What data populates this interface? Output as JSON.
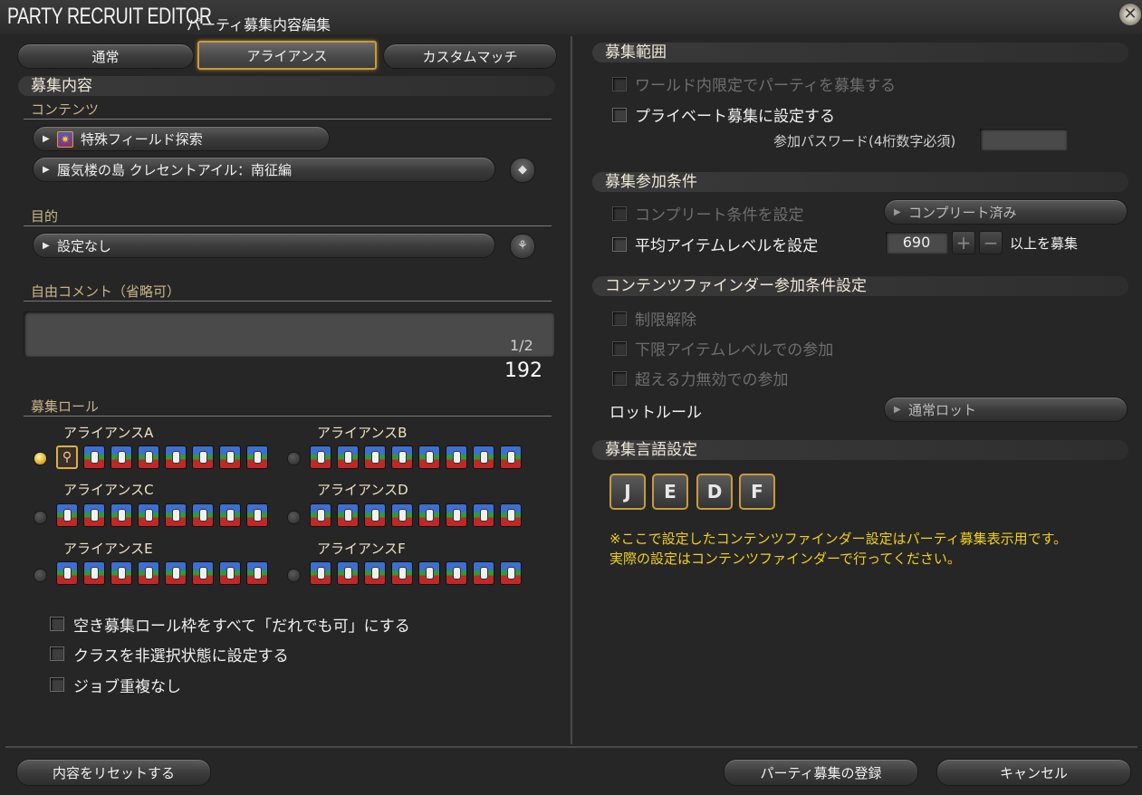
{
  "window": {
    "title": "PARTY RECRUIT EDITOR",
    "subtitle": "パーティ募集内容編集",
    "close_icon": "close-icon"
  },
  "tabs": [
    {
      "label": "通常",
      "active": false
    },
    {
      "label": "アライアンス",
      "active": true
    },
    {
      "label": "カスタムマッチ",
      "active": false
    }
  ],
  "left": {
    "section_title": "募集内容",
    "contents": {
      "heading": "コンテンツ",
      "category": "特殊フィールド探索",
      "duty": "蜃気楼の島 クレセントアイル：南征編"
    },
    "objective": {
      "heading": "目的",
      "value": "設定なし"
    },
    "comment": {
      "heading": "自由コメント（省略可）",
      "value": "",
      "page": "1/2",
      "remaining": "192"
    },
    "roles": {
      "heading": "募集ロール",
      "alliances": [
        {
          "name": "アライアンスA",
          "selected": true
        },
        {
          "name": "アライアンスB",
          "selected": false
        },
        {
          "name": "アライアンスC",
          "selected": false
        },
        {
          "name": "アライアンスD",
          "selected": false
        },
        {
          "name": "アライアンスE",
          "selected": false
        },
        {
          "name": "アライアンスF",
          "selected": false
        }
      ]
    },
    "options": [
      {
        "label": "空き募集ロール枠をすべて「だれでも可」にする",
        "checked": false
      },
      {
        "label": "クラスを非選択状態に設定する",
        "checked": false
      },
      {
        "label": "ジョブ重複なし",
        "checked": false
      }
    ]
  },
  "right": {
    "scope": {
      "title": "募集範囲",
      "world_only": "ワールド内限定でパーティを募集する",
      "private": "プライベート募集に設定する",
      "password_label": "参加パスワード(4桁数字必須)",
      "password_value": ""
    },
    "conditions": {
      "title": "募集参加条件",
      "complete_label": "コンプリート条件を設定",
      "complete_value": "コンプリート済み",
      "avg_ilvl_label": "平均アイテムレベルを設定",
      "avg_ilvl_value": "690",
      "plus": "+",
      "minus": "−",
      "avg_ilvl_suffix": "以上を募集"
    },
    "cf": {
      "title": "コンテンツファインダー参加条件設定",
      "unrestricted": "制限解除",
      "min_ilvl": "下限アイテムレベルでの参加",
      "echo_off": "超える力無効での参加",
      "loot_label": "ロットルール",
      "loot_value": "通常ロット"
    },
    "language": {
      "title": "募集言語設定",
      "keys": [
        "J",
        "E",
        "D",
        "F"
      ],
      "note1": "※ここで設定したコンテンツファインダー設定はパーティ募集表示用です。",
      "note2": "実際の設定はコンテンツファインダーで行ってください。"
    }
  },
  "footer": {
    "reset": "内容をリセットする",
    "register": "パーティ募集の登録",
    "cancel": "キャンセル"
  },
  "colors": {
    "accent_gold": "#c89b3c",
    "note_yellow": "#f0d020",
    "background": "#262626"
  }
}
